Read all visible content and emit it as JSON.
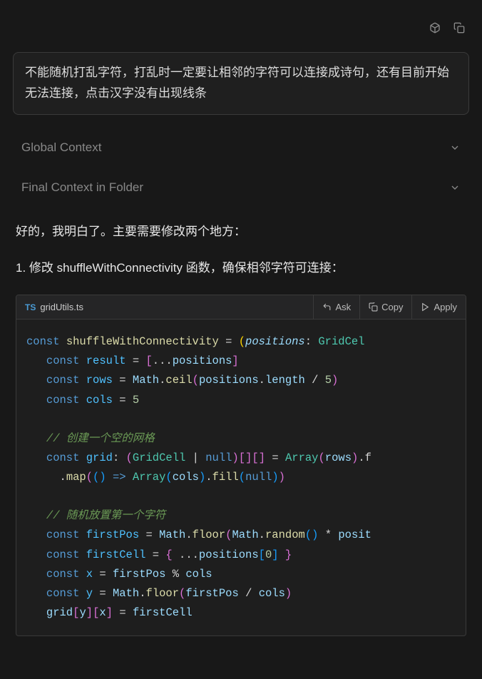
{
  "top_icons": {
    "cube": "cube-icon",
    "copy": "copy-icon"
  },
  "user_message": "不能随机打乱字符，打乱时一定要让相邻的字符可以连接成诗句，还有目前开始无法连接，点击汉字没有出现线条",
  "sections": {
    "global": "Global Context",
    "final": "Final Context in Folder"
  },
  "assistant": {
    "intro": "好的，我明白了。主要需要修改两个地方：",
    "point1": "1. 修改 shuffleWithConnectivity 函数，确保相邻字符可连接："
  },
  "code": {
    "lang_badge": "TS",
    "filename": "gridUtils.ts",
    "actions": {
      "ask": "Ask",
      "copy": "Copy",
      "apply": "Apply"
    },
    "tokens": {
      "const": "const",
      "fn_name": "shuffleWithConnectivity",
      "eq": " = ",
      "positions": "positions",
      "colon": ": ",
      "gridcell": "GridCel",
      "result": "result",
      "spread_positions": "positions",
      "rows": "rows",
      "math": "Math",
      "ceil": "ceil",
      "length": "length",
      "div5": " / ",
      "five": "5",
      "cols": "cols",
      "cmt1": "// 创建一个空的网格",
      "grid": "grid",
      "gridtype": "GridCell",
      "null": "null",
      "array": "Array",
      "map": "map",
      "fill": "fill",
      "cmt2": "// 随机放置第一个字符",
      "firstPos": "firstPos",
      "floor": "floor",
      "random": "random",
      "posit": "posit",
      "firstCell": "firstCell",
      "zero": "0",
      "x": "x",
      "mod": " % ",
      "y": "y",
      "f_suffix": ".f"
    }
  }
}
